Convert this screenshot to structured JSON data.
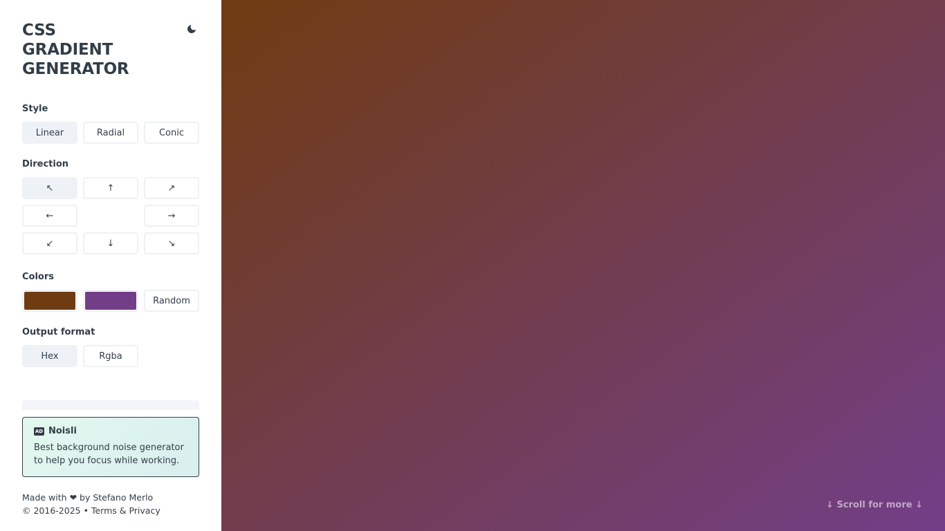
{
  "app": {
    "title_lines": [
      "CSS",
      "GRADIENT",
      "GENERATOR"
    ],
    "theme_toggle_icon": "moon-icon"
  },
  "style": {
    "label": "Style",
    "options": [
      "Linear",
      "Radial",
      "Conic"
    ],
    "selected": "Linear"
  },
  "direction": {
    "label": "Direction",
    "options": [
      {
        "icon": "arrow-up-left-icon",
        "glyph": "↖"
      },
      {
        "icon": "arrow-up-icon",
        "glyph": "↑"
      },
      {
        "icon": "arrow-up-right-icon",
        "glyph": "↗"
      },
      {
        "icon": "arrow-left-icon",
        "glyph": "←"
      },
      {
        "icon": "arrow-right-icon",
        "glyph": "→"
      },
      {
        "icon": "arrow-down-left-icon",
        "glyph": "↙"
      },
      {
        "icon": "arrow-down-icon",
        "glyph": "↓"
      },
      {
        "icon": "arrow-down-right-icon",
        "glyph": "↘"
      }
    ],
    "selected": "arrow-up-left-icon"
  },
  "colors": {
    "label": "Colors",
    "color_1": "#6f3c12",
    "color_2": "#733e88",
    "random_label": "Random"
  },
  "output_format": {
    "label": "Output format",
    "options": [
      "Hex",
      "Rgba"
    ],
    "selected": "Hex"
  },
  "ad": {
    "icon": "ad-badge-icon",
    "icon_text": "AD",
    "name": "Noisli",
    "text": "Best background noise generator to help you focus while working."
  },
  "footer": {
    "made_with_prefix": "Made with",
    "heart": "❤",
    "made_with_suffix": "by Stefano Merlo",
    "copyright": "© 2016-2025 •",
    "terms_link": "Terms & Privacy"
  },
  "preview": {
    "scroll_hint": "↓ Scroll for more ↓"
  },
  "colors_theme": {
    "text": "#333d47",
    "active_button": "#eef2f7",
    "button_border": "#eef1f4"
  }
}
